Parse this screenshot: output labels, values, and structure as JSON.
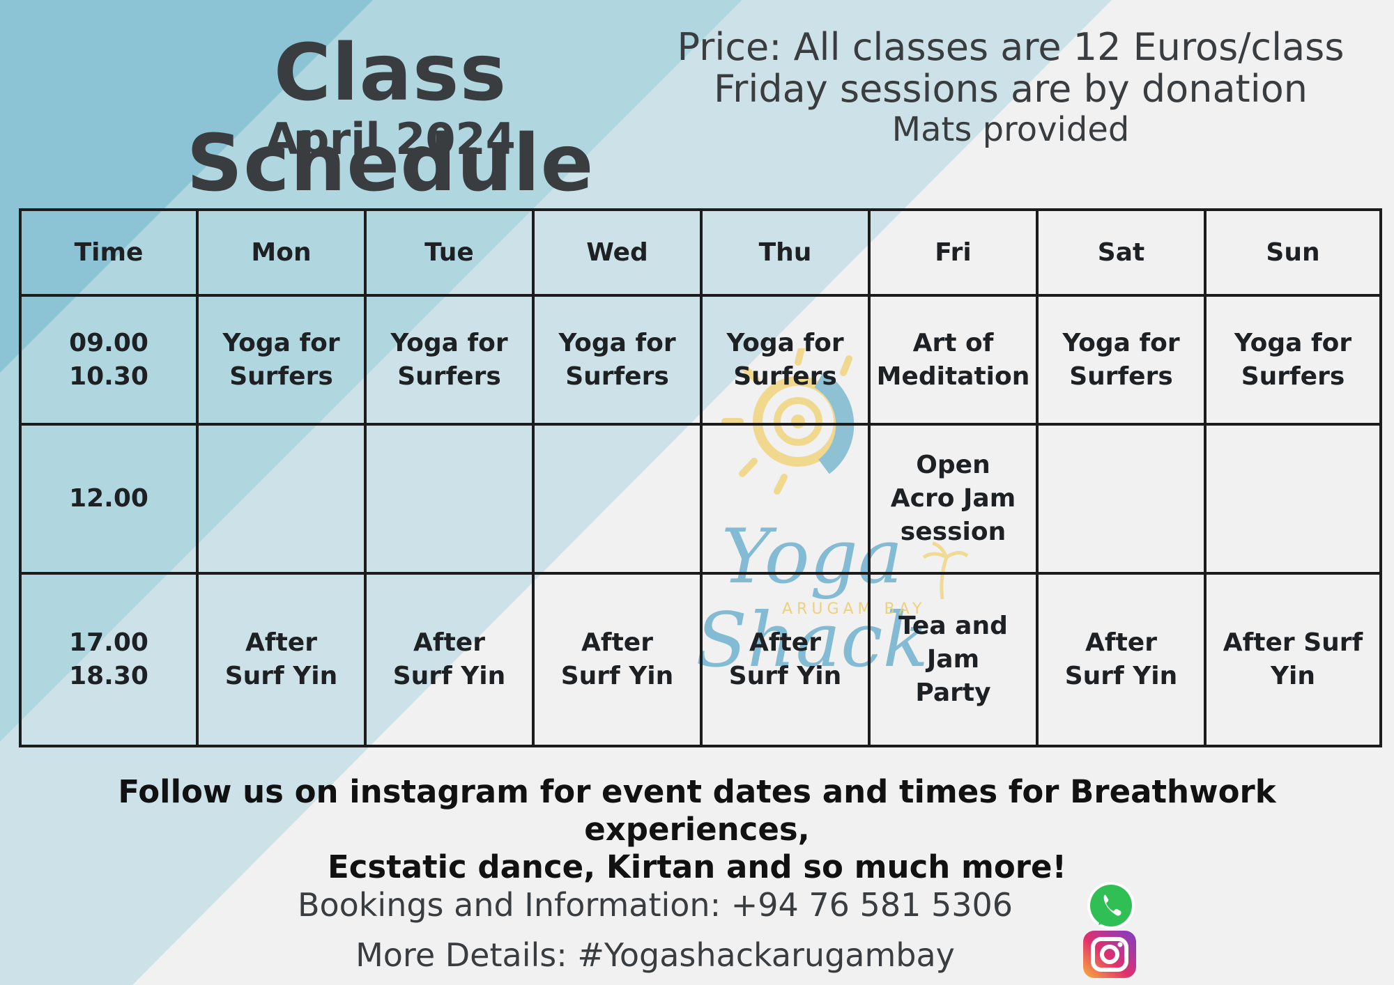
{
  "header": {
    "title": "Class Schedule",
    "subtitle": "April 2024",
    "price_line1": "Price: All classes are 12 Euros/class",
    "price_line2": "Friday sessions are by donation",
    "price_line3": "Mats provided"
  },
  "schedule": {
    "headers": [
      "Time",
      "Mon",
      "Tue",
      "Wed",
      "Thu",
      "Fri",
      "Sat",
      "Sun"
    ],
    "rows": [
      {
        "time": [
          "09.00",
          "10.30"
        ],
        "cells": [
          [
            "Yoga for",
            "Surfers"
          ],
          [
            "Yoga for",
            "Surfers"
          ],
          [
            "Yoga for",
            "Surfers"
          ],
          [
            "Yoga for",
            "Surfers"
          ],
          [
            "Art of",
            "Meditation"
          ],
          [
            "Yoga for",
            "Surfers"
          ],
          [
            "Yoga for",
            "Surfers"
          ]
        ]
      },
      {
        "time": [
          "12.00"
        ],
        "cells": [
          [],
          [],
          [],
          [],
          [
            "Open",
            "Acro Jam",
            "session"
          ],
          [],
          []
        ]
      },
      {
        "time": [
          "17.00",
          "18.30"
        ],
        "cells": [
          [
            "After",
            "Surf Yin"
          ],
          [
            "After",
            "Surf Yin"
          ],
          [
            "After",
            "Surf Yin"
          ],
          [
            "After",
            "Surf Yin"
          ],
          [
            "Tea and",
            "Jam",
            "Party"
          ],
          [
            "After",
            "Surf Yin"
          ],
          [
            "After Surf",
            "Yin"
          ]
        ]
      }
    ]
  },
  "watermark": {
    "text": "Yoga Shack",
    "subtext": "ARUGAM BAY"
  },
  "footer": {
    "follow_line1": "Follow us on instagram for event dates and times for Breathwork experiences,",
    "follow_line2": "Ecstatic dance, Kirtan and so much more!",
    "bookings": "Bookings and Information:  +94 76 581 5306",
    "details": "More Details: #Yogashackarugambay"
  },
  "icons": {
    "whatsapp": "whatsapp-icon",
    "instagram": "instagram-icon"
  },
  "colors": {
    "stripe_dark": "#8cc4d6",
    "stripe_mid": "#b0d6e0",
    "stripe_light": "#cde2e8",
    "background": "#f1f1f1",
    "text": "#3a3d40"
  }
}
